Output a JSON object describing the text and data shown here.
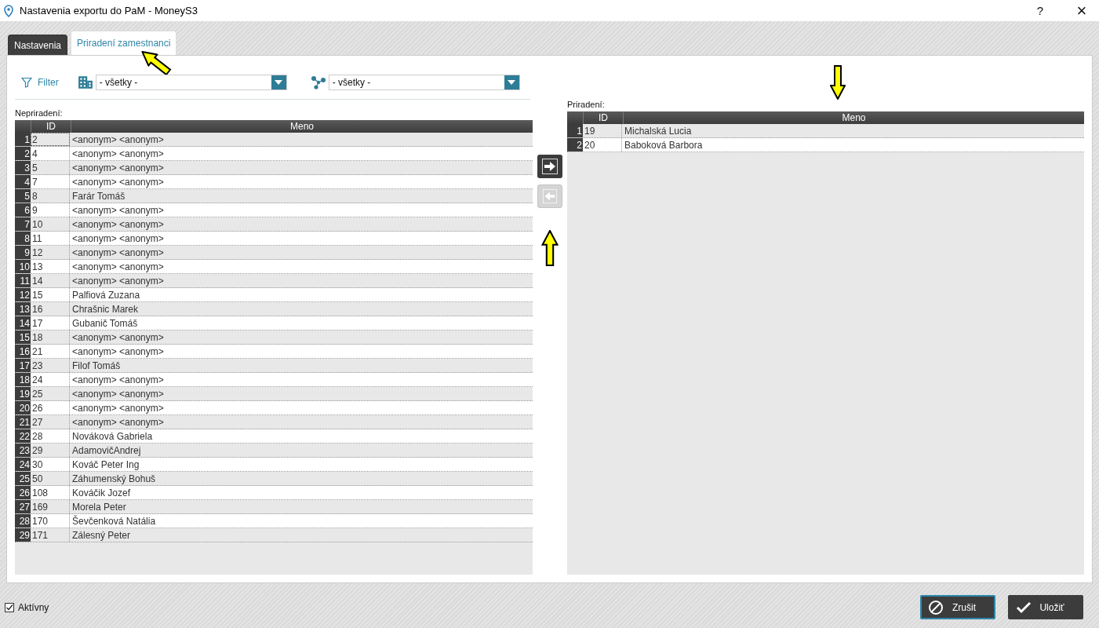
{
  "window": {
    "title": "Nastavenia exportu do PaM - MoneyS3",
    "help": "?",
    "close": "×"
  },
  "tabs": [
    {
      "label": "Nastavenia",
      "selected": false
    },
    {
      "label": "Priradení zamestnanci",
      "selected": true
    }
  ],
  "filter": {
    "label": "Filter",
    "dropdowns": [
      {
        "kind": "building",
        "value": "- všetky -"
      },
      {
        "kind": "network",
        "value": "- všetky -"
      }
    ]
  },
  "unassigned": {
    "label": "Nepriradení:",
    "columns": [
      "ID",
      "Meno"
    ],
    "rows": [
      {
        "num": "1",
        "id": "2",
        "name": "<anonym> <anonym>",
        "selected": true
      },
      {
        "num": "2",
        "id": "4",
        "name": "<anonym> <anonym>",
        "selected": false
      },
      {
        "num": "3",
        "id": "5",
        "name": "<anonym> <anonym>",
        "selected": false
      },
      {
        "num": "4",
        "id": "7",
        "name": "<anonym> <anonym>",
        "selected": false
      },
      {
        "num": "5",
        "id": "8",
        "name": "Farár Tomáš",
        "selected": false
      },
      {
        "num": "6",
        "id": "9",
        "name": "<anonym> <anonym>",
        "selected": false
      },
      {
        "num": "7",
        "id": "10",
        "name": "<anonym> <anonym>",
        "selected": false
      },
      {
        "num": "8",
        "id": "11",
        "name": "<anonym> <anonym>",
        "selected": false
      },
      {
        "num": "9",
        "id": "12",
        "name": "<anonym> <anonym>",
        "selected": false
      },
      {
        "num": "10",
        "id": "13",
        "name": "<anonym> <anonym>",
        "selected": false
      },
      {
        "num": "11",
        "id": "14",
        "name": "<anonym> <anonym>",
        "selected": false
      },
      {
        "num": "12",
        "id": "15",
        "name": "Palfiová Zuzana",
        "selected": false
      },
      {
        "num": "13",
        "id": "16",
        "name": "Chrašnic Marek",
        "selected": false
      },
      {
        "num": "14",
        "id": "17",
        "name": "Gubanič Tomáš",
        "selected": false
      },
      {
        "num": "15",
        "id": "18",
        "name": "<anonym> <anonym>",
        "selected": false
      },
      {
        "num": "16",
        "id": "21",
        "name": "<anonym> <anonym>",
        "selected": false
      },
      {
        "num": "17",
        "id": "23",
        "name": "Filof Tomáš",
        "selected": false
      },
      {
        "num": "18",
        "id": "24",
        "name": "<anonym> <anonym>",
        "selected": false
      },
      {
        "num": "19",
        "id": "25",
        "name": "<anonym> <anonym>",
        "selected": false
      },
      {
        "num": "20",
        "id": "26",
        "name": "<anonym> <anonym>",
        "selected": false
      },
      {
        "num": "21",
        "id": "27",
        "name": "<anonym> <anonym>",
        "selected": false
      },
      {
        "num": "22",
        "id": "28",
        "name": "Nováková Gabriela",
        "selected": false
      },
      {
        "num": "23",
        "id": "29",
        "name": "AdamovičAndrej",
        "selected": false
      },
      {
        "num": "24",
        "id": "30",
        "name": "Kováč Peter Ing",
        "selected": false
      },
      {
        "num": "25",
        "id": "50",
        "name": "Záhumenský Bohuš",
        "selected": false
      },
      {
        "num": "26",
        "id": "108",
        "name": "Kováčik Jozef",
        "selected": false
      },
      {
        "num": "27",
        "id": "169",
        "name": "Morela Peter",
        "selected": false
      },
      {
        "num": "28",
        "id": "170",
        "name": "Ševčenková Natália",
        "selected": false
      },
      {
        "num": "29",
        "id": "171",
        "name": "Zálesný Peter",
        "selected": false
      }
    ]
  },
  "move_buttons": [
    {
      "kind": "right",
      "disabled": false
    },
    {
      "kind": "left",
      "disabled": true
    }
  ],
  "assigned": {
    "label": "Priradení:",
    "columns": [
      "ID",
      "Meno"
    ],
    "rows": [
      {
        "num": "1",
        "id": "19",
        "name": "Michalská Lucia",
        "selected": false
      },
      {
        "num": "2",
        "id": "20",
        "name": "Baboková Barbora",
        "selected": false
      }
    ]
  },
  "active": {
    "label": "Aktívny",
    "checked": true
  },
  "buttons": [
    {
      "kind": "cancel",
      "label": "Zrušit",
      "focused": true
    },
    {
      "kind": "save",
      "label": "Uložiť",
      "focused": false
    }
  ]
}
